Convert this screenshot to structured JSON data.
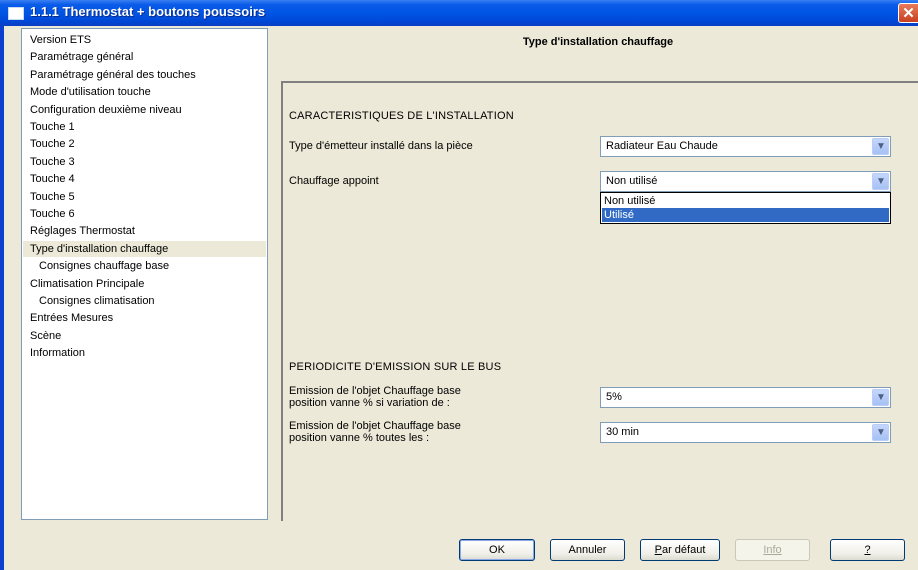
{
  "window": {
    "title": "1.1.1 Thermostat + boutons poussoirs",
    "close_glyph": "✕"
  },
  "tree": {
    "items": [
      {
        "label": "Version ETS",
        "indent": false,
        "selected": false
      },
      {
        "label": "Paramétrage général",
        "indent": false,
        "selected": false
      },
      {
        "label": "Paramétrage général des touches",
        "indent": false,
        "selected": false
      },
      {
        "label": "Mode d'utilisation touche",
        "indent": false,
        "selected": false
      },
      {
        "label": "Configuration deuxième niveau",
        "indent": false,
        "selected": false
      },
      {
        "label": "Touche 1",
        "indent": false,
        "selected": false
      },
      {
        "label": "Touche 2",
        "indent": false,
        "selected": false
      },
      {
        "label": "Touche 3",
        "indent": false,
        "selected": false
      },
      {
        "label": "Touche 4",
        "indent": false,
        "selected": false
      },
      {
        "label": "Touche 5",
        "indent": false,
        "selected": false
      },
      {
        "label": "Touche 6",
        "indent": false,
        "selected": false
      },
      {
        "label": "Réglages Thermostat",
        "indent": false,
        "selected": false
      },
      {
        "label": "Type d'installation chauffage",
        "indent": false,
        "selected": true
      },
      {
        "label": "Consignes chauffage base",
        "indent": true,
        "selected": false
      },
      {
        "label": "Climatisation Principale",
        "indent": false,
        "selected": false
      },
      {
        "label": "Consignes climatisation",
        "indent": true,
        "selected": false
      },
      {
        "label": "Entrées Mesures",
        "indent": false,
        "selected": false
      },
      {
        "label": "Scène",
        "indent": false,
        "selected": false
      },
      {
        "label": "Information",
        "indent": false,
        "selected": false
      }
    ]
  },
  "panel": {
    "title": "Type d'installation chauffage",
    "section1": "CARACTERISTIQUES DE L'INSTALLATION",
    "emitter_label": "Type d'émetteur installé dans la pièce",
    "emitter_value": "Radiateur Eau Chaude",
    "appoint_label": "Chauffage appoint",
    "appoint_value": "Non utilisé",
    "appoint_options": [
      "Non utilisé",
      "Utilisé"
    ],
    "appoint_highlighted": "Utilisé",
    "section2": "PERIODICITE D'EMISSION SUR LE BUS",
    "variation_label_1": "Emission de l'objet Chauffage base",
    "variation_label_2": "position vanne % si variation de :",
    "variation_value": "5%",
    "period_label_1": "Emission de l'objet Chauffage base",
    "period_label_2": "position vanne % toutes les :",
    "period_value": "30 min"
  },
  "buttons": {
    "ok": "OK",
    "cancel": "Annuler",
    "default_first": "P",
    "default_rest": "ar défaut",
    "info": "Info",
    "help": "?"
  },
  "colors": {
    "titlebar": "#0055e5",
    "selection": "#316ac5",
    "face": "#ece9d8"
  },
  "icons": {
    "combo_arrow": "▼"
  }
}
